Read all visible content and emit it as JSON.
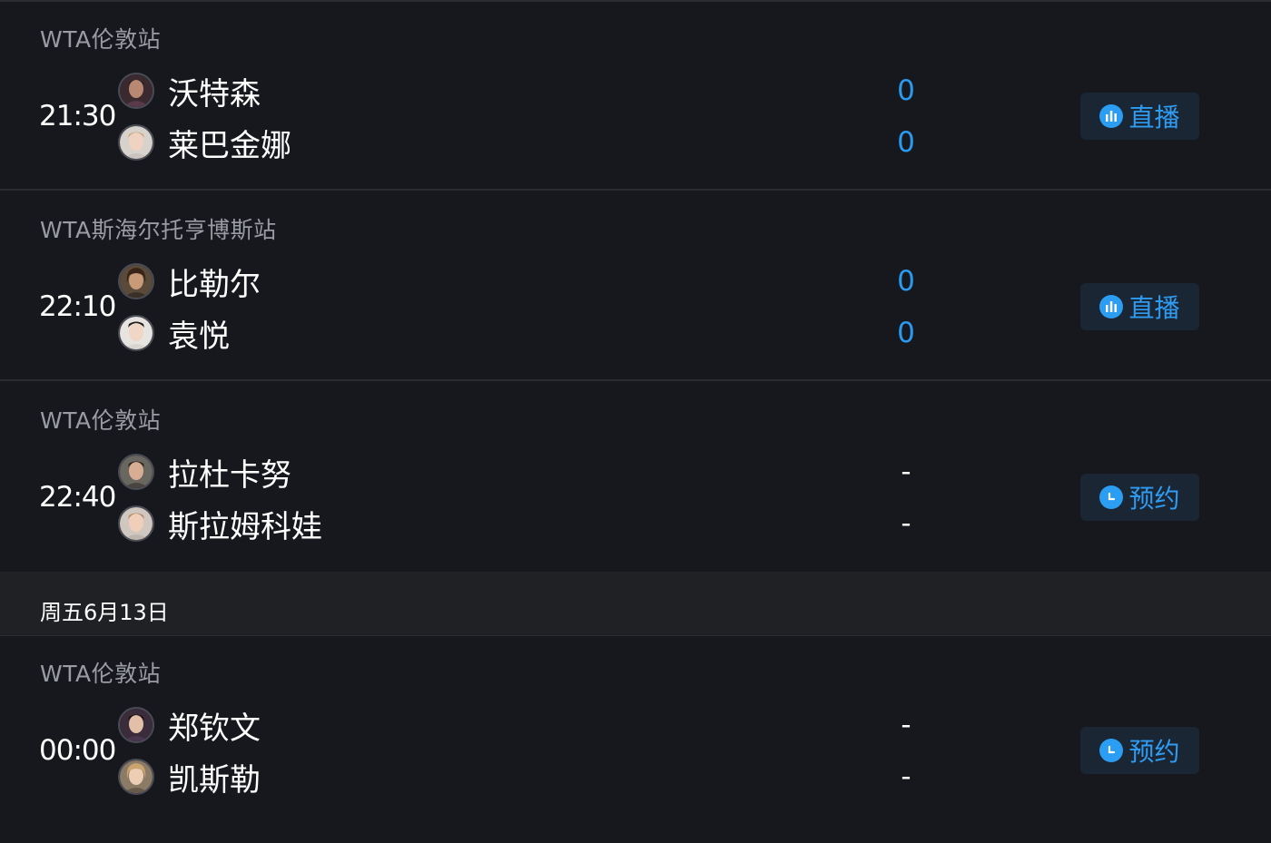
{
  "matches": [
    {
      "league": "WTA伦敦站",
      "time": "21:30",
      "players": [
        {
          "name": "沃特森",
          "score": "0"
        },
        {
          "name": "莱巴金娜",
          "score": "0"
        }
      ],
      "button": {
        "label": "直播",
        "icon": "live-icon"
      }
    },
    {
      "league": "WTA斯海尔托亨博斯站",
      "time": "22:10",
      "players": [
        {
          "name": "比勒尔",
          "score": "0"
        },
        {
          "name": "袁悦",
          "score": "0"
        }
      ],
      "button": {
        "label": "直播",
        "icon": "live-icon"
      }
    },
    {
      "league": "WTA伦敦站",
      "time": "22:40",
      "players": [
        {
          "name": "拉杜卡努",
          "score": "-"
        },
        {
          "name": "斯拉姆科娃",
          "score": "-"
        }
      ],
      "button": {
        "label": "预约",
        "icon": "clock-icon"
      }
    },
    {
      "league": "WTA伦敦站",
      "time": "00:00",
      "players": [
        {
          "name": "郑钦文",
          "score": "-"
        },
        {
          "name": "凯斯勒",
          "score": "-"
        }
      ],
      "button": {
        "label": "预约",
        "icon": "clock-icon"
      }
    }
  ],
  "date_header": "周五6月13日",
  "colors": {
    "background": "#17181d",
    "score_blue": "#2a9af0",
    "button_bg": "#1b2634",
    "button_text": "#2f9cf4",
    "league_gray": "#9a9ca3",
    "date_bar": "#202125"
  }
}
